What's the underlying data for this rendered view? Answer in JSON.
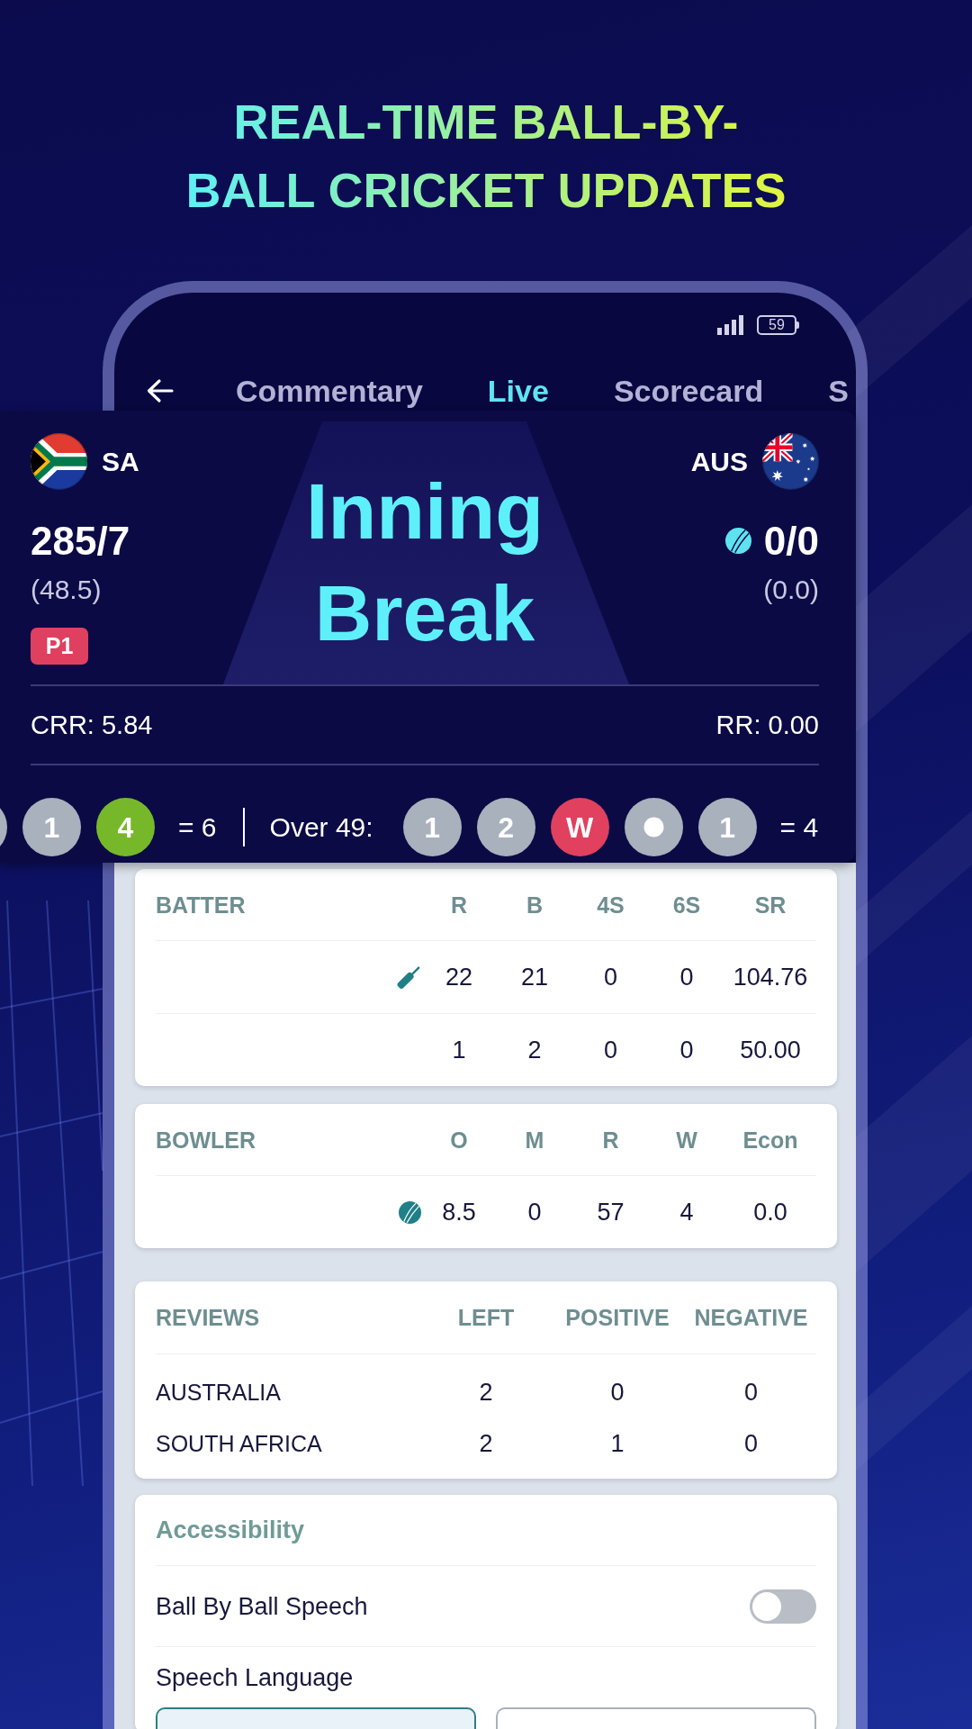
{
  "headline": "REAL-TIME BALL-BY-BALL CRICKET UPDATES",
  "status_bar": {
    "battery": "59"
  },
  "tabs": [
    {
      "label": "Commentary",
      "selected": false
    },
    {
      "label": "Live",
      "selected": true
    },
    {
      "label": "Scorecard",
      "selected": false
    },
    {
      "label": "S",
      "selected": false
    }
  ],
  "score_card": {
    "teams": [
      {
        "name": "SA",
        "score": "285/7",
        "overs": "(48.5)",
        "badge": "P1",
        "batting": false
      },
      {
        "name": "AUS",
        "score": "0/0",
        "overs": "(0.0)",
        "batting": true
      }
    ],
    "status": "Inning Break",
    "rates": [
      "CRR: 5.84",
      "RR: 0.00"
    ],
    "overs": [
      {
        "balls": [
          {
            "kind": "run"
          },
          {
            "kind": "run",
            "label": "1"
          },
          {
            "kind": "four",
            "label": "4"
          }
        ],
        "total": "= 6"
      },
      {
        "title": "Over 49:",
        "balls": [
          {
            "kind": "run",
            "label": "1"
          },
          {
            "kind": "run",
            "label": "2"
          },
          {
            "kind": "wicket",
            "label": "W"
          },
          {
            "kind": "dot"
          },
          {
            "kind": "run",
            "label": "1"
          }
        ],
        "total": "= 4"
      }
    ]
  },
  "batting": {
    "kind": "batting",
    "columns": [
      "BATTER",
      "R",
      "B",
      "4S",
      "6S",
      "SR"
    ],
    "rows": [
      {
        "current": true,
        "values": [
          "22",
          "21",
          "0",
          "0",
          "104.76"
        ]
      },
      {
        "current": false,
        "values": [
          "1",
          "2",
          "0",
          "0",
          "50.00"
        ]
      }
    ]
  },
  "bowling": {
    "kind": "bowling",
    "columns": [
      "BOWLER",
      "O",
      "M",
      "R",
      "W",
      "Econ"
    ],
    "rows": [
      {
        "current": true,
        "values": [
          "8.5",
          "0",
          "57",
          "4",
          "0.0"
        ]
      }
    ]
  },
  "reviews": {
    "columns": [
      "REVIEWS",
      "LEFT",
      "POSITIVE",
      "NEGATIVE"
    ],
    "rows": [
      {
        "team": "AUSTRALIA",
        "values": [
          "2",
          "0",
          "0"
        ]
      },
      {
        "team": "SOUTH AFRICA",
        "values": [
          "2",
          "1",
          "0"
        ]
      }
    ]
  },
  "accessibility": {
    "title": "Accessibility",
    "toggles": [
      {
        "label": "Ball By Ball Speech",
        "on": false
      }
    ],
    "language_label": "Speech Language",
    "language_options": [
      {
        "selected": true
      },
      {
        "selected": false
      }
    ]
  }
}
